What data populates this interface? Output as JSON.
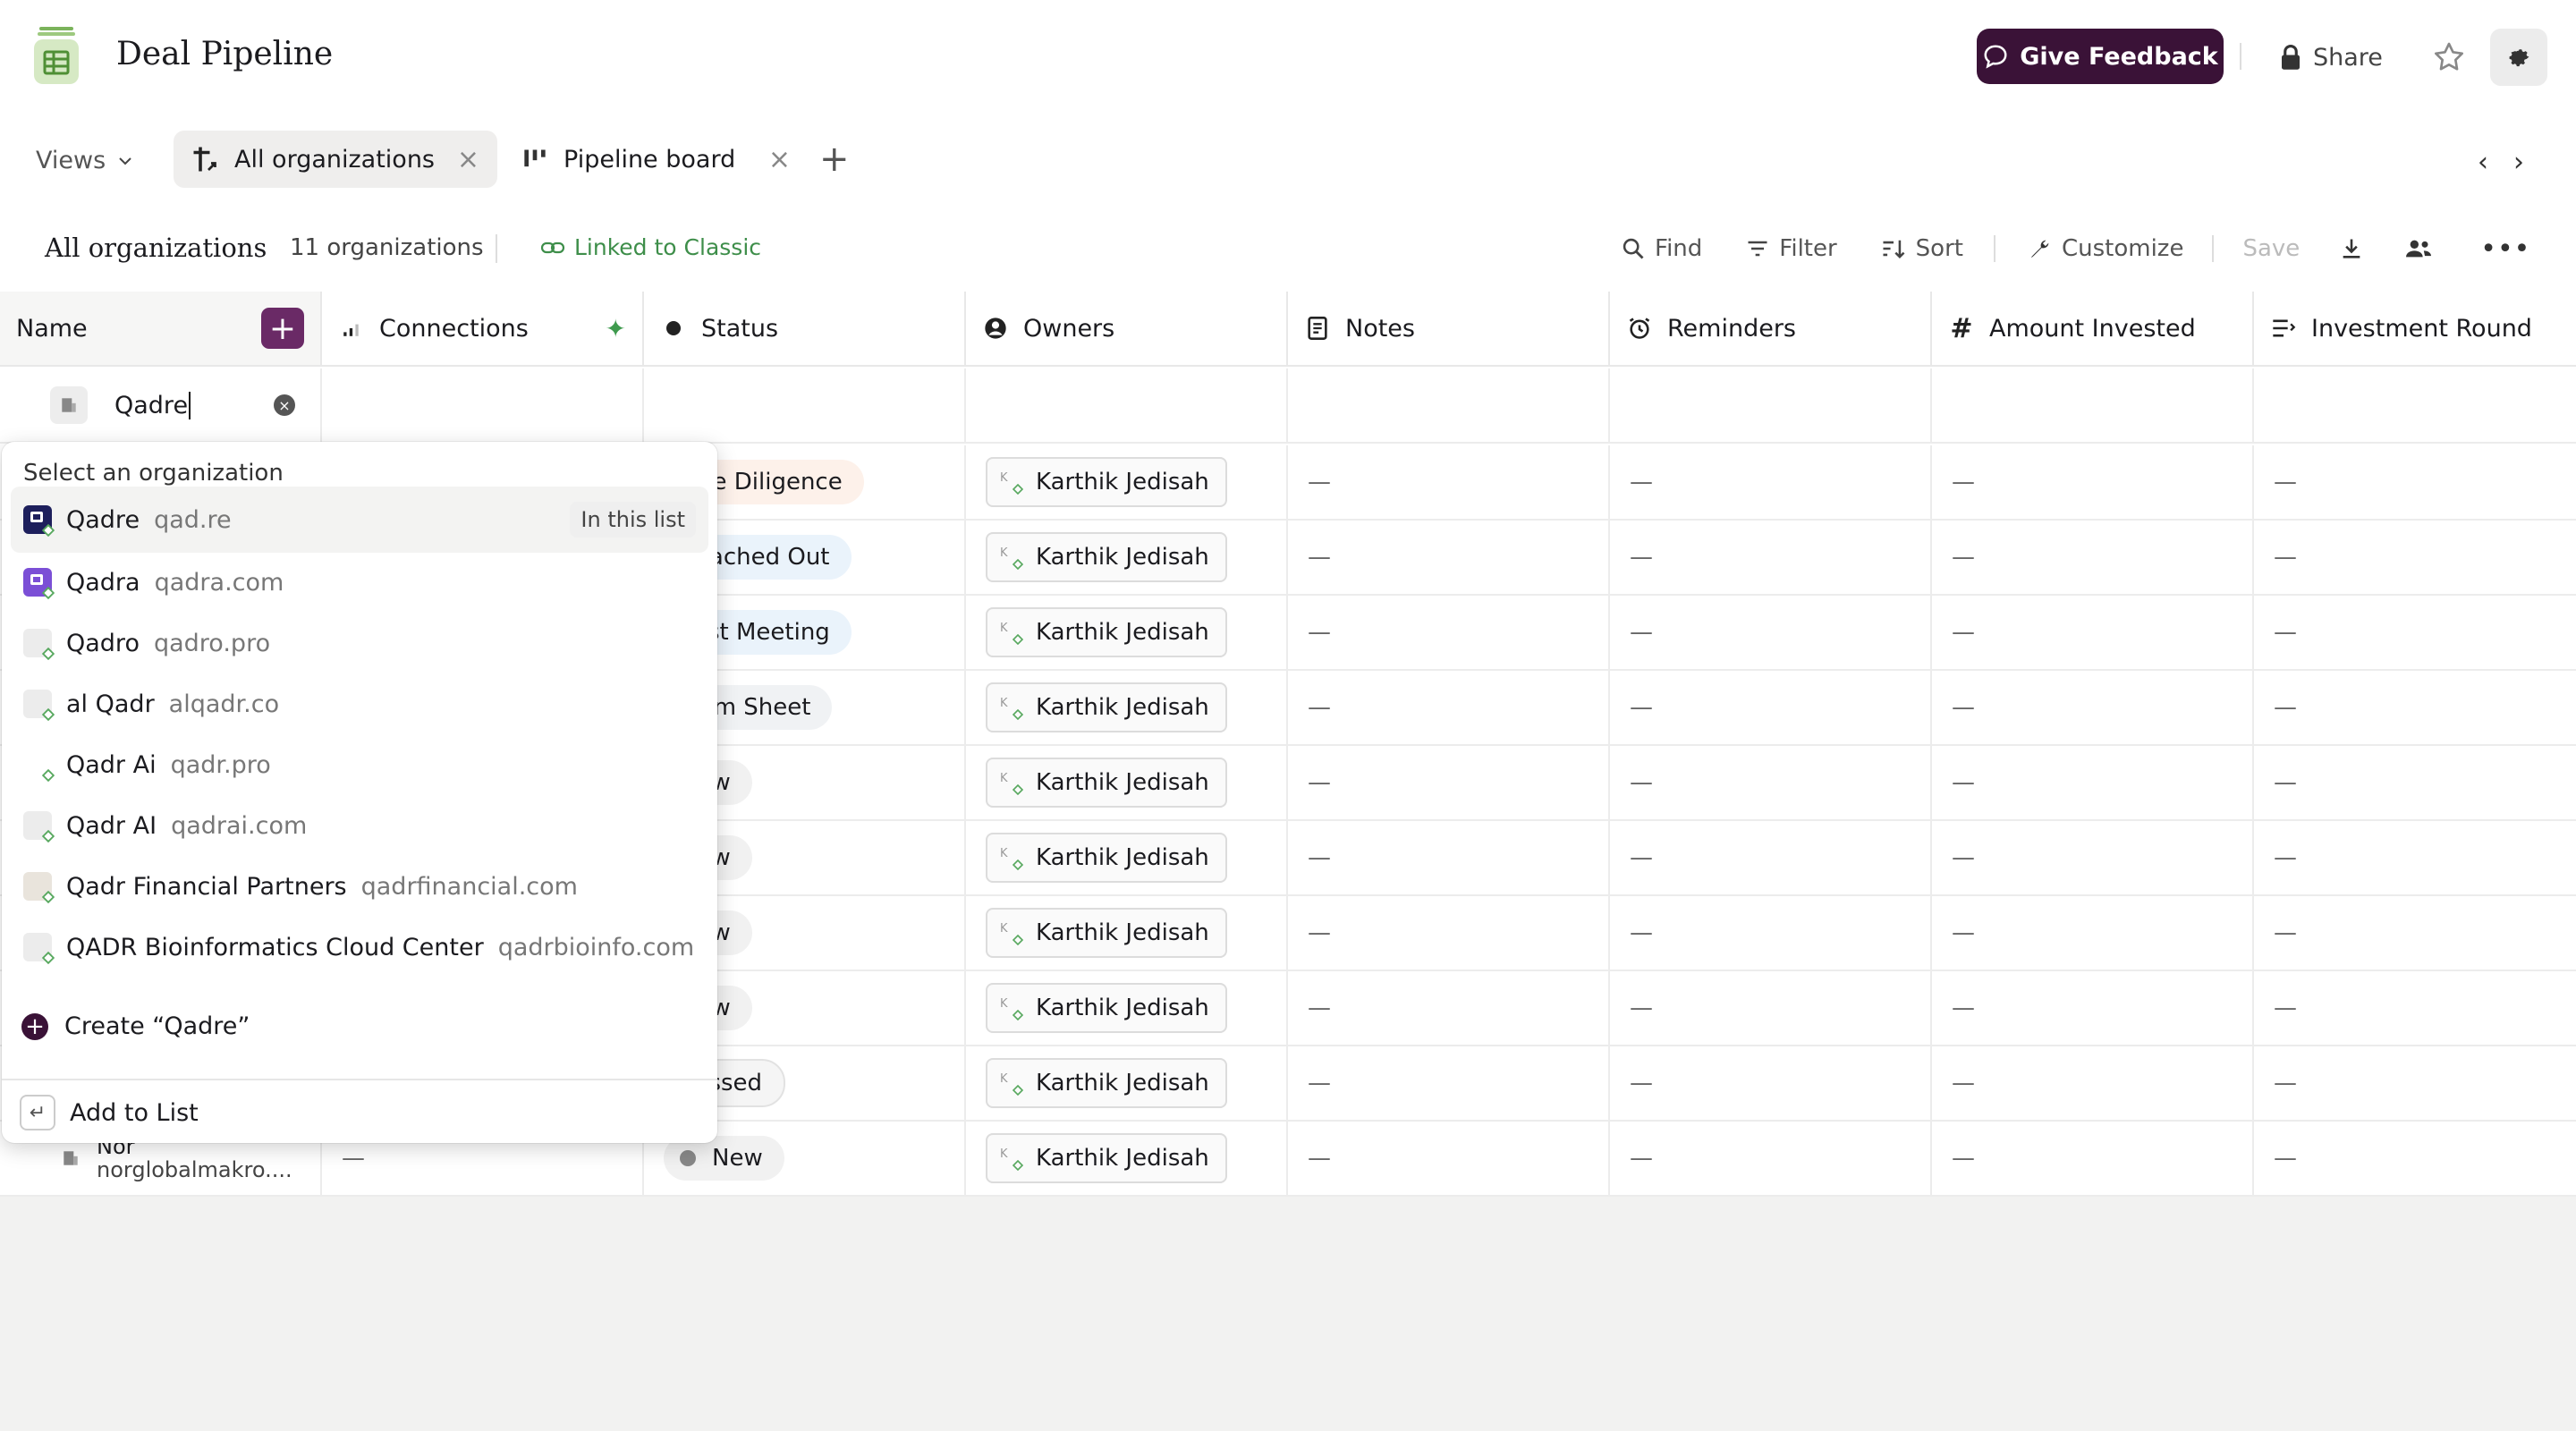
{
  "header": {
    "title": "Deal Pipeline",
    "feedback_label": "Give Feedback",
    "share_label": "Share"
  },
  "tabs": {
    "views_label": "Views",
    "items": [
      {
        "label": "All organizations"
      },
      {
        "label": "Pipeline board"
      }
    ]
  },
  "toolbar": {
    "title": "All organizations",
    "count": "11 organizations",
    "linked": "Linked to Classic",
    "find": "Find",
    "filter": "Filter",
    "sort": "Sort",
    "customize": "Customize",
    "save": "Save"
  },
  "grid": {
    "columns": [
      {
        "label": "Name",
        "icon": "none"
      },
      {
        "label": "Connections",
        "icon": "signal-bars-icon"
      },
      {
        "label": "Status",
        "icon": "dot-icon"
      },
      {
        "label": "Owners",
        "icon": "user-circle-icon"
      },
      {
        "label": "Notes",
        "icon": "note-icon"
      },
      {
        "label": "Reminders",
        "icon": "alarm-icon"
      },
      {
        "label": "Amount Invested",
        "icon": "hash-icon"
      },
      {
        "label": "Investment Round",
        "icon": "list-icon"
      }
    ],
    "name_input_value": "Qadre",
    "rows": [
      {
        "status": "Due Diligence",
        "owner": "Karthik Jedisah"
      },
      {
        "status": "Reached Out",
        "owner": "Karthik Jedisah"
      },
      {
        "status": "First Meeting",
        "owner": "Karthik Jedisah"
      },
      {
        "status": "Term Sheet",
        "owner": "Karthik Jedisah"
      },
      {
        "status": "New",
        "owner": "Karthik Jedisah"
      },
      {
        "status": "New",
        "owner": "Karthik Jedisah"
      },
      {
        "status": "New",
        "owner": "Karthik Jedisah"
      },
      {
        "status": "New",
        "owner": "Karthik Jedisah"
      },
      {
        "status": "Passed",
        "owner": "Karthik Jedisah"
      },
      {
        "status": "New",
        "owner": "Karthik Jedisah",
        "name": "Nor",
        "domain": "norglobalmakro...."
      }
    ],
    "dash": "—",
    "avatar_initials": "K"
  },
  "dropdown": {
    "header": "Select an organization",
    "options": [
      {
        "name": "Qadre",
        "domain": "qad.re",
        "badge": "In this list"
      },
      {
        "name": "Qadra",
        "domain": "qadra.com"
      },
      {
        "name": "Qadro",
        "domain": "qadro.pro"
      },
      {
        "name": "al Qadr",
        "domain": "alqadr.co"
      },
      {
        "name": "Qadr Ai",
        "domain": "qadr.pro"
      },
      {
        "name": "Qadr AI",
        "domain": "qadrai.com"
      },
      {
        "name": "Qadr Financial Partners",
        "domain": "qadrfinancial.com"
      },
      {
        "name": "QADR Bioinformatics Cloud Center",
        "domain": "qadrbioinfo.com"
      }
    ],
    "create_label": "Create “Qadre”",
    "add_label": "Add to List",
    "enter_symbol": "↵"
  },
  "colors": {
    "brand": "#3a1237",
    "accent_green": "#3e8e4a",
    "status_due": "#fdf1ea",
    "status_reached": "#eaf3fb",
    "status_first": "#eaf3fb",
    "status_term": "#f0f2f4",
    "status_new": "#f1f1f1",
    "status_passed": "#f5f5f5"
  }
}
